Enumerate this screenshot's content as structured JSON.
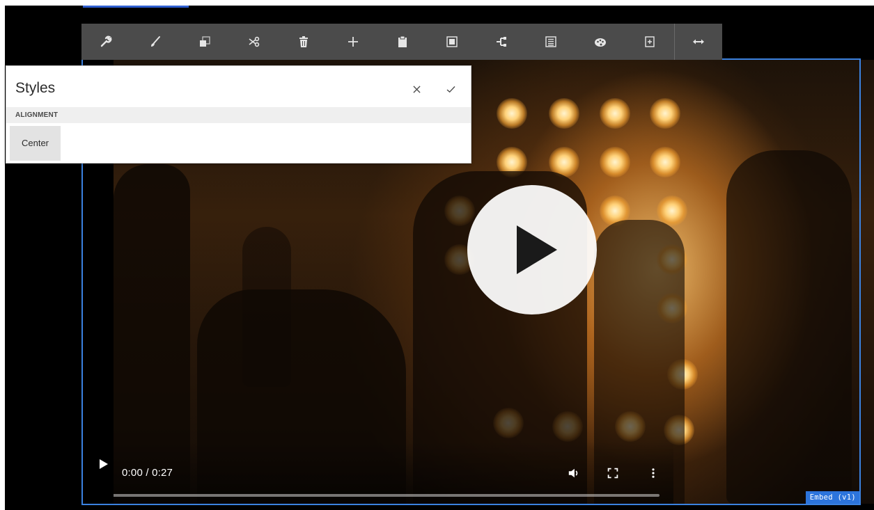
{
  "toolbar": {
    "buttons": [
      {
        "name": "configure",
        "icon": "wrench-icon"
      },
      {
        "name": "styles",
        "icon": "paintbrush-icon"
      },
      {
        "name": "copy",
        "icon": "copy-icon"
      },
      {
        "name": "cut",
        "icon": "scissors-icon"
      },
      {
        "name": "delete",
        "icon": "trash-icon"
      },
      {
        "name": "insert",
        "icon": "plus-icon"
      },
      {
        "name": "paste",
        "icon": "clipboard-icon"
      },
      {
        "name": "group",
        "icon": "group-frame-icon"
      },
      {
        "name": "parent",
        "icon": "parent-tree-icon"
      },
      {
        "name": "layout",
        "icon": "layout-icon"
      },
      {
        "name": "theme",
        "icon": "palette-icon"
      },
      {
        "name": "template",
        "icon": "template-icon"
      },
      {
        "name": "resize",
        "icon": "horizontal-arrows-icon"
      }
    ]
  },
  "styles_popover": {
    "title": "Styles",
    "close_icon": "close-icon",
    "confirm_icon": "checkmark-icon",
    "section_label": "ALIGNMENT",
    "option_label": "Center"
  },
  "video": {
    "time_display": "0:00 / 0:27",
    "progress_fraction": 0.0
  },
  "component_label": "Embed (v1)",
  "colors": {
    "toolbar_bg": "#4b4b4b",
    "frame_border": "#3b82e0",
    "label_bg": "#2c74dc"
  }
}
